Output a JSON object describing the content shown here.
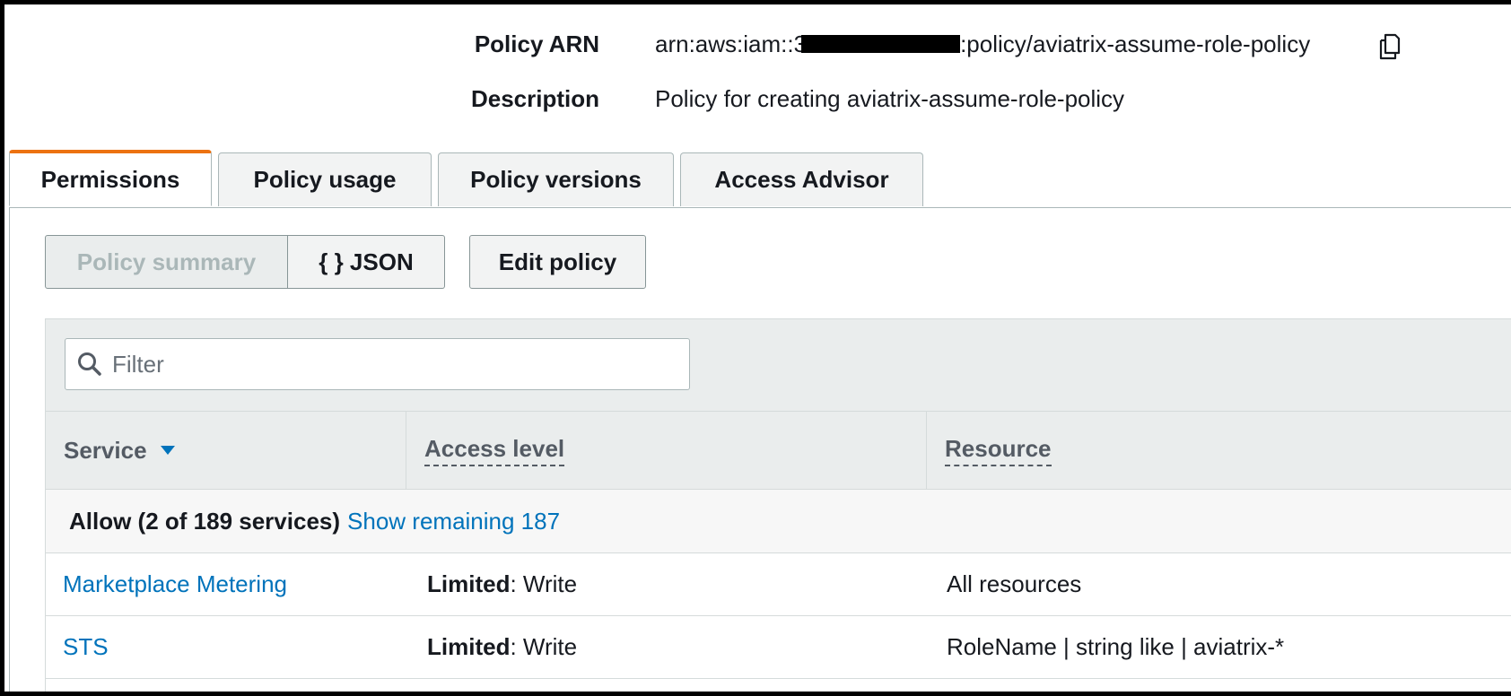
{
  "summary": {
    "arn_label": "Policy ARN",
    "arn_prefix": "arn:aws:iam::3",
    "arn_suffix": ":policy/aviatrix-assume-role-policy",
    "description_label": "Description",
    "description_value": "Policy for creating aviatrix-assume-role-policy",
    "copy_icon": "copy-icon"
  },
  "tabs": [
    {
      "label": "Permissions",
      "active": true
    },
    {
      "label": "Policy usage",
      "active": false
    },
    {
      "label": "Policy versions",
      "active": false
    },
    {
      "label": "Access Advisor",
      "active": false
    }
  ],
  "view_toggle": {
    "summary_label": "Policy summary",
    "json_label": "{ } JSON",
    "selected": "summary"
  },
  "edit_button_label": "Edit policy",
  "filter": {
    "placeholder": "Filter",
    "value": "",
    "icon": "search-icon"
  },
  "table": {
    "columns": [
      "Service",
      "Access level",
      "Resource"
    ],
    "sort_icon": "caret-down-icon",
    "group": {
      "label": "Allow (2 of 189 services)",
      "link": "Show remaining 187"
    },
    "rows": [
      {
        "service": "Marketplace Metering",
        "access_strong": "Limited",
        "access_rest": ": Write",
        "resource": "All resources"
      },
      {
        "service": "STS",
        "access_strong": "Limited",
        "access_rest": ": Write",
        "resource": "RoleName | string like | aviatrix-*"
      }
    ]
  },
  "colors": {
    "accent_orange": "#ec7211",
    "link_blue": "#0073bb",
    "sort_icon_blue": "#0073bb"
  }
}
